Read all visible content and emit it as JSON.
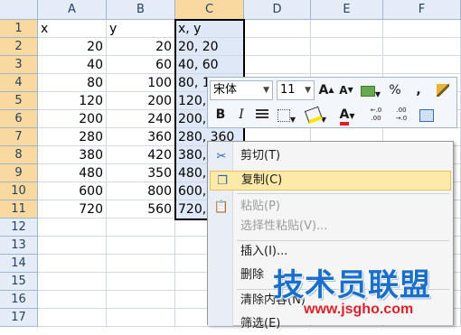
{
  "columns": [
    "A",
    "B",
    "C",
    "D",
    "E",
    "F"
  ],
  "rows": [
    {
      "num": "1",
      "a": "x",
      "b": "y",
      "c": "x, y"
    },
    {
      "num": "2",
      "a": "20",
      "b": "20",
      "c": "20, 20"
    },
    {
      "num": "3",
      "a": "40",
      "b": "60",
      "c": "40, 60"
    },
    {
      "num": "4",
      "a": "80",
      "b": "100",
      "c": "80, 1"
    },
    {
      "num": "5",
      "a": "120",
      "b": "200",
      "c": "120,"
    },
    {
      "num": "6",
      "a": "200",
      "b": "240",
      "c": "200,"
    },
    {
      "num": "7",
      "a": "280",
      "b": "360",
      "c": "280, 360"
    },
    {
      "num": "8",
      "a": "380",
      "b": "420",
      "c": "380,"
    },
    {
      "num": "9",
      "a": "480",
      "b": "350",
      "c": "480,"
    },
    {
      "num": "10",
      "a": "600",
      "b": "800",
      "c": "600,"
    },
    {
      "num": "11",
      "a": "720",
      "b": "560",
      "c": "720,"
    },
    {
      "num": "12",
      "a": "",
      "b": "",
      "c": ""
    },
    {
      "num": "13",
      "a": "",
      "b": "",
      "c": ""
    },
    {
      "num": "14",
      "a": "",
      "b": "",
      "c": ""
    },
    {
      "num": "15",
      "a": "",
      "b": "",
      "c": ""
    },
    {
      "num": "16",
      "a": "",
      "b": "",
      "c": ""
    },
    {
      "num": "17",
      "a": "",
      "b": "",
      "c": ""
    }
  ],
  "mini_toolbar": {
    "font_name": "宋体",
    "font_size": "11",
    "grow_font": "A",
    "shrink_font": "A",
    "percent": "%",
    "comma": ",",
    "bold": "B",
    "italic": "I",
    "font_color": "A",
    "inc_decimal": "+.0\n.00",
    "dec_decimal": ".00\n→.0"
  },
  "context_menu": {
    "items": [
      {
        "label": "剪切(T)",
        "icon": "scissors-icon",
        "disabled": false,
        "highlighted": false
      },
      {
        "label": "复制(C)",
        "icon": "copy-icon",
        "disabled": false,
        "highlighted": true
      },
      {
        "label": "粘贴(P)",
        "icon": "paste-icon",
        "disabled": true,
        "highlighted": false
      },
      {
        "label": "选择性粘贴(V)...",
        "icon": "",
        "disabled": true,
        "highlighted": false
      },
      {
        "label": "插入(I)...",
        "icon": "",
        "disabled": false,
        "highlighted": false
      },
      {
        "label": "删除",
        "icon": "",
        "disabled": false,
        "highlighted": false
      },
      {
        "label": "清除内容(N)",
        "icon": "",
        "disabled": false,
        "highlighted": false
      },
      {
        "label": "筛选(E)",
        "icon": "",
        "disabled": false,
        "highlighted": false
      }
    ]
  },
  "watermark": {
    "brand": "技术员联盟",
    "url": "www.jsgho.com"
  },
  "colors": {
    "header_bg": "#e4ecf7",
    "header_selected": "#f9d99f",
    "menu_highlight": "#fde9a8",
    "watermark_blue": "#1b6fc8",
    "watermark_red": "#d8232a"
  }
}
